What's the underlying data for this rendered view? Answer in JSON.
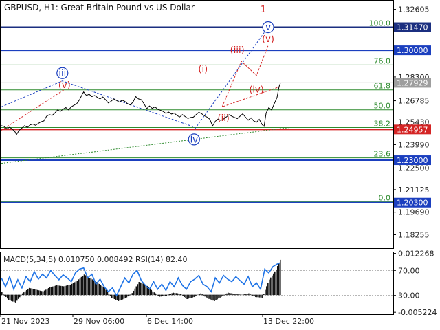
{
  "chart_data": {
    "type": "line",
    "title": "GBPUSD, H1:  Great Britain Pound vs US Dollar",
    "price_ticks": [
      "1.32605",
      "1.28300",
      "1.26785",
      "1.25430",
      "1.23990",
      "1.22500",
      "1.21125",
      "1.19690",
      "1.18255"
    ],
    "price_tick_values": [
      1.32605,
      1.283,
      1.26785,
      1.2543,
      1.2399,
      1.225,
      1.21125,
      1.1969,
      1.18255
    ],
    "ylim": [
      1.174,
      1.332
    ],
    "x_labels": [
      "21 Nov 2023",
      "29 Nov 06:00",
      "6 Dec 14:00",
      "13 Dec 22:00"
    ],
    "horizontal_levels": [
      {
        "value": 1.3147,
        "label": "1.31470",
        "color": "#1b2f80"
      },
      {
        "value": 1.3,
        "label": "1.30000",
        "color": "#1b3fbf"
      },
      {
        "value": 1.27929,
        "label": "1.27929",
        "color": "#9e9e9e"
      },
      {
        "value": 1.24957,
        "label": "1.24957",
        "color": "#d42424"
      },
      {
        "value": 1.23,
        "label": "1.23000",
        "color": "#1b3fbf"
      },
      {
        "value": 1.203,
        "label": "1.20300",
        "color": "#1b3fbf"
      }
    ],
    "fibonacci": [
      {
        "level": "100.0",
        "price": 1.3147
      },
      {
        "level": "76.0",
        "price": 1.2907
      },
      {
        "level": "61.8",
        "price": 1.2748
      },
      {
        "level": "50.0",
        "price": 1.2621
      },
      {
        "level": "38.2",
        "price": 1.2508
      },
      {
        "level": "23.6",
        "price": 1.2315
      },
      {
        "level": "0.0",
        "price": 1.2035
      }
    ],
    "fib_color": "#2e8b2e",
    "price_series": [
      [
        0,
        1.252
      ],
      [
        4,
        1.2515
      ],
      [
        8,
        1.25
      ],
      [
        12,
        1.251
      ],
      [
        16,
        1.2498
      ],
      [
        20,
        1.248
      ],
      [
        22,
        1.2462
      ],
      [
        26,
        1.249
      ],
      [
        30,
        1.2505
      ],
      [
        34,
        1.252
      ],
      [
        38,
        1.2508
      ],
      [
        42,
        1.2525
      ],
      [
        46,
        1.253
      ],
      [
        50,
        1.2522
      ],
      [
        54,
        1.2535
      ],
      [
        58,
        1.2545
      ],
      [
        62,
        1.255
      ],
      [
        66,
        1.258
      ],
      [
        70,
        1.259
      ],
      [
        74,
        1.2585
      ],
      [
        78,
        1.26
      ],
      [
        82,
        1.262
      ],
      [
        86,
        1.261
      ],
      [
        90,
        1.2625
      ],
      [
        94,
        1.2635
      ],
      [
        98,
        1.262
      ],
      [
        102,
        1.264
      ],
      [
        106,
        1.265
      ],
      [
        110,
        1.266
      ],
      [
        114,
        1.2685
      ],
      [
        118,
        1.272
      ],
      [
        120,
        1.2735
      ],
      [
        124,
        1.2712
      ],
      [
        128,
        1.272
      ],
      [
        132,
        1.2705
      ],
      [
        136,
        1.2712
      ],
      [
        140,
        1.27
      ],
      [
        144,
        1.269
      ],
      [
        148,
        1.2703
      ],
      [
        152,
        1.2685
      ],
      [
        156,
        1.2665
      ],
      [
        160,
        1.2675
      ],
      [
        164,
        1.269
      ],
      [
        168,
        1.268
      ],
      [
        172,
        1.267
      ],
      [
        176,
        1.2682
      ],
      [
        180,
        1.2675
      ],
      [
        184,
        1.266
      ],
      [
        188,
        1.2652
      ],
      [
        192,
        1.267
      ],
      [
        196,
        1.2705
      ],
      [
        200,
        1.269
      ],
      [
        204,
        1.2685
      ],
      [
        208,
        1.266
      ],
      [
        212,
        1.2628
      ],
      [
        216,
        1.2645
      ],
      [
        220,
        1.263
      ],
      [
        224,
        1.264
      ],
      [
        228,
        1.2625
      ],
      [
        232,
        1.2618
      ],
      [
        236,
        1.261
      ],
      [
        240,
        1.2598
      ],
      [
        244,
        1.2606
      ],
      [
        248,
        1.2594
      ],
      [
        252,
        1.26
      ],
      [
        256,
        1.2585
      ],
      [
        260,
        1.2575
      ],
      [
        264,
        1.259
      ],
      [
        268,
        1.2578
      ],
      [
        272,
        1.2566
      ],
      [
        276,
        1.2572
      ],
      [
        280,
        1.2574
      ],
      [
        284,
        1.259
      ],
      [
        288,
        1.2605
      ],
      [
        292,
        1.2596
      ],
      [
        296,
        1.2583
      ],
      [
        300,
        1.2574
      ],
      [
        304,
        1.256
      ],
      [
        308,
        1.2518
      ],
      [
        312,
        1.2548
      ],
      [
        316,
        1.2562
      ],
      [
        320,
        1.2553
      ],
      [
        324,
        1.2562
      ],
      [
        328,
        1.2575
      ],
      [
        332,
        1.259
      ],
      [
        336,
        1.258
      ],
      [
        340,
        1.2572
      ],
      [
        344,
        1.2565
      ],
      [
        348,
        1.258
      ],
      [
        352,
        1.2595
      ],
      [
        356,
        1.2574
      ],
      [
        360,
        1.2555
      ],
      [
        364,
        1.257
      ],
      [
        368,
        1.255
      ],
      [
        372,
        1.2542
      ],
      [
        376,
        1.256
      ],
      [
        380,
        1.2528
      ],
      [
        383,
        1.2515
      ],
      [
        386,
        1.26
      ],
      [
        390,
        1.2635
      ],
      [
        394,
        1.262
      ],
      [
        398,
        1.266
      ],
      [
        402,
        1.27
      ],
      [
        405,
        1.277
      ],
      [
        407,
        1.2793
      ]
    ],
    "macd_label": "MACD(5,34,5) 0.010750 0.008492 RSI(14) 82.40",
    "macd_ticks": [
      "0.012268",
      "70.00",
      "30.00",
      "-0.005224"
    ],
    "macd_tick_values": [
      0.012268,
      70.0,
      30.0,
      -0.005224
    ],
    "macd_ylim": [
      -0.0058,
      0.0128
    ],
    "rsi_ylim": [
      0,
      100
    ],
    "macd_series": [
      [
        0,
        0.0008
      ],
      [
        10,
        -0.0015
      ],
      [
        20,
        -0.0022
      ],
      [
        30,
        0.0004
      ],
      [
        40,
        0.002
      ],
      [
        50,
        0.0015
      ],
      [
        60,
        0.001
      ],
      [
        70,
        0.0022
      ],
      [
        80,
        0.0028
      ],
      [
        90,
        0.0025
      ],
      [
        100,
        0.003
      ],
      [
        110,
        0.0042
      ],
      [
        120,
        0.006
      ],
      [
        130,
        0.0048
      ],
      [
        140,
        0.0035
      ],
      [
        150,
        0.002
      ],
      [
        160,
        -0.0008
      ],
      [
        170,
        -0.0018
      ],
      [
        180,
        -0.001
      ],
      [
        190,
        0.0005
      ],
      [
        200,
        0.0038
      ],
      [
        210,
        0.003
      ],
      [
        220,
        0.001
      ],
      [
        230,
        -0.0005
      ],
      [
        240,
        -0.0002
      ],
      [
        250,
        0.0006
      ],
      [
        260,
        0.0003
      ],
      [
        270,
        -0.0012
      ],
      [
        280,
        -0.0006
      ],
      [
        290,
        0.0004
      ],
      [
        300,
        -0.001
      ],
      [
        310,
        -0.0018
      ],
      [
        320,
        -0.0005
      ],
      [
        330,
        0.0006
      ],
      [
        340,
        0.0002
      ],
      [
        350,
        0.0
      ],
      [
        360,
        0.0004
      ],
      [
        370,
        -0.0006
      ],
      [
        380,
        -0.0008
      ],
      [
        385,
        0.002
      ],
      [
        390,
        0.0045
      ],
      [
        395,
        0.006
      ],
      [
        400,
        0.0075
      ],
      [
        404,
        0.0095
      ],
      [
        407,
        0.0108
      ]
    ],
    "rsi_series": [
      [
        0,
        58
      ],
      [
        6,
        44
      ],
      [
        12,
        60
      ],
      [
        18,
        40
      ],
      [
        24,
        55
      ],
      [
        30,
        42
      ],
      [
        36,
        60
      ],
      [
        42,
        52
      ],
      [
        48,
        68
      ],
      [
        54,
        56
      ],
      [
        60,
        64
      ],
      [
        66,
        58
      ],
      [
        72,
        70
      ],
      [
        78,
        62
      ],
      [
        84,
        55
      ],
      [
        90,
        63
      ],
      [
        96,
        58
      ],
      [
        102,
        52
      ],
      [
        108,
        66
      ],
      [
        114,
        72
      ],
      [
        120,
        74
      ],
      [
        126,
        58
      ],
      [
        132,
        64
      ],
      [
        138,
        48
      ],
      [
        144,
        56
      ],
      [
        150,
        44
      ],
      [
        156,
        36
      ],
      [
        162,
        42
      ],
      [
        168,
        30
      ],
      [
        174,
        44
      ],
      [
        180,
        58
      ],
      [
        186,
        50
      ],
      [
        192,
        64
      ],
      [
        198,
        70
      ],
      [
        204,
        54
      ],
      [
        210,
        46
      ],
      [
        216,
        40
      ],
      [
        222,
        52
      ],
      [
        228,
        40
      ],
      [
        234,
        48
      ],
      [
        240,
        38
      ],
      [
        246,
        52
      ],
      [
        252,
        44
      ],
      [
        258,
        58
      ],
      [
        264,
        46
      ],
      [
        270,
        40
      ],
      [
        276,
        52
      ],
      [
        282,
        56
      ],
      [
        288,
        62
      ],
      [
        294,
        48
      ],
      [
        300,
        44
      ],
      [
        306,
        36
      ],
      [
        312,
        58
      ],
      [
        318,
        50
      ],
      [
        324,
        62
      ],
      [
        330,
        56
      ],
      [
        336,
        52
      ],
      [
        342,
        60
      ],
      [
        348,
        54
      ],
      [
        354,
        48
      ],
      [
        360,
        60
      ],
      [
        366,
        44
      ],
      [
        372,
        50
      ],
      [
        378,
        40
      ],
      [
        384,
        72
      ],
      [
        390,
        66
      ],
      [
        396,
        76
      ],
      [
        402,
        80
      ],
      [
        407,
        82.4
      ]
    ],
    "rsi_color": "#1e73e6",
    "wave_labels": [
      {
        "text": "1",
        "color": "#d42424",
        "circled": false,
        "x": 382,
        "y": 1.3262
      },
      {
        "text": "v",
        "color": "#1b3fbf",
        "circled": true,
        "x": 389,
        "y": 1.3147
      },
      {
        "text": "(v)",
        "color": "#d42424",
        "circled": false,
        "x": 389,
        "y": 1.3073
      },
      {
        "text": "(iii)",
        "color": "#d42424",
        "circled": false,
        "x": 344,
        "y": 1.3003
      },
      {
        "text": "(i)",
        "color": "#d42424",
        "circled": false,
        "x": 294,
        "y": 1.2882
      },
      {
        "text": "iii",
        "color": "#1b3fbf",
        "circled": true,
        "x": 89,
        "y": 1.2855
      },
      {
        "text": "(v)",
        "color": "#d42424",
        "circled": false,
        "x": 92,
        "y": 1.278
      },
      {
        "text": "(iv)",
        "color": "#d42424",
        "circled": false,
        "x": 372,
        "y": 1.275
      },
      {
        "text": "(ii)",
        "color": "#d42424",
        "circled": false,
        "x": 324,
        "y": 1.257
      },
      {
        "text": "iv",
        "color": "#1b3fbf",
        "circled": true,
        "x": 281,
        "y": 1.2432
      }
    ],
    "forecast_red": [
      [
        407,
        1.277
      ],
      [
        322,
        1.264
      ],
      [
        350,
        1.293
      ],
      [
        372,
        1.284
      ],
      [
        389,
        1.303
      ]
    ],
    "forecast_blue": [
      [
        282,
        1.2498
      ],
      [
        389,
        1.3147
      ]
    ],
    "trend_blue": [
      [
        0,
        1.264
      ],
      [
        89,
        1.2805
      ],
      [
        282,
        1.251
      ]
    ],
    "trend_red": [
      [
        0,
        1.249
      ],
      [
        92,
        1.275
      ]
    ],
    "support_green": [
      [
        0,
        1.228
      ],
      [
        420,
        1.2508
      ]
    ]
  }
}
